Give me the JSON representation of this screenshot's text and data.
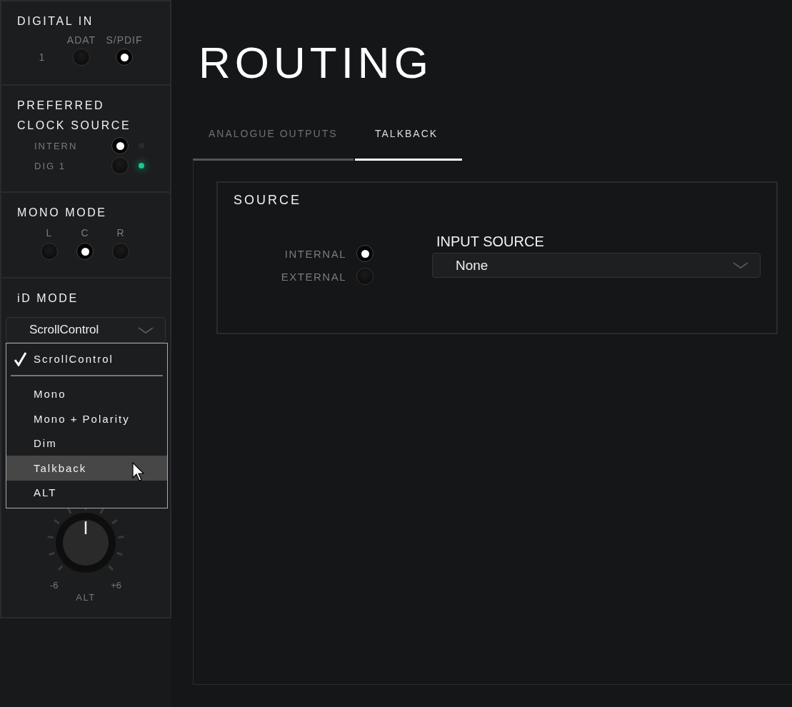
{
  "sidebar": {
    "digital_in": {
      "title": "DIGITAL IN",
      "row_label": "1",
      "options": [
        {
          "label": "ADAT",
          "selected": false
        },
        {
          "label": "S/PDIF",
          "selected": true
        }
      ]
    },
    "clock_source": {
      "title": "PREFERRED CLOCK SOURCE",
      "options": [
        {
          "label": "INTERN",
          "selected": true,
          "lock_indicator": false
        },
        {
          "label": "DIG 1",
          "selected": false,
          "lock_indicator": true
        }
      ]
    },
    "mono_mode": {
      "title": "MONO MODE",
      "options": [
        {
          "label": "L",
          "selected": false
        },
        {
          "label": "C",
          "selected": true
        },
        {
          "label": "R",
          "selected": false
        }
      ]
    },
    "id_mode": {
      "title": "iD MODE",
      "dropdown": {
        "value": "ScrollControl",
        "expanded": true,
        "items": [
          {
            "label": "ScrollControl",
            "checked": true,
            "highlighted": false
          },
          {
            "label": "Mono",
            "checked": false,
            "highlighted": false
          },
          {
            "label": "Mono + Polarity",
            "checked": false,
            "highlighted": false
          },
          {
            "label": "Dim",
            "checked": false,
            "highlighted": false
          },
          {
            "label": "Talkback",
            "checked": false,
            "highlighted": true
          },
          {
            "label": "ALT",
            "checked": false,
            "highlighted": false
          }
        ]
      },
      "knob": {
        "min_label": "-6",
        "max_label": "+6",
        "label": "ALT"
      }
    }
  },
  "main": {
    "title": "ROUTING",
    "tabs": [
      {
        "label": "ANALOGUE OUTPUTS",
        "selected": false
      },
      {
        "label": "TALKBACK",
        "selected": true
      }
    ],
    "source": {
      "title": "SOURCE",
      "options": [
        {
          "label": "INTERNAL",
          "selected": true
        },
        {
          "label": "EXTERNAL",
          "selected": false
        }
      ],
      "input_source": {
        "label": "INPUT SOURCE",
        "value": "None"
      }
    }
  }
}
